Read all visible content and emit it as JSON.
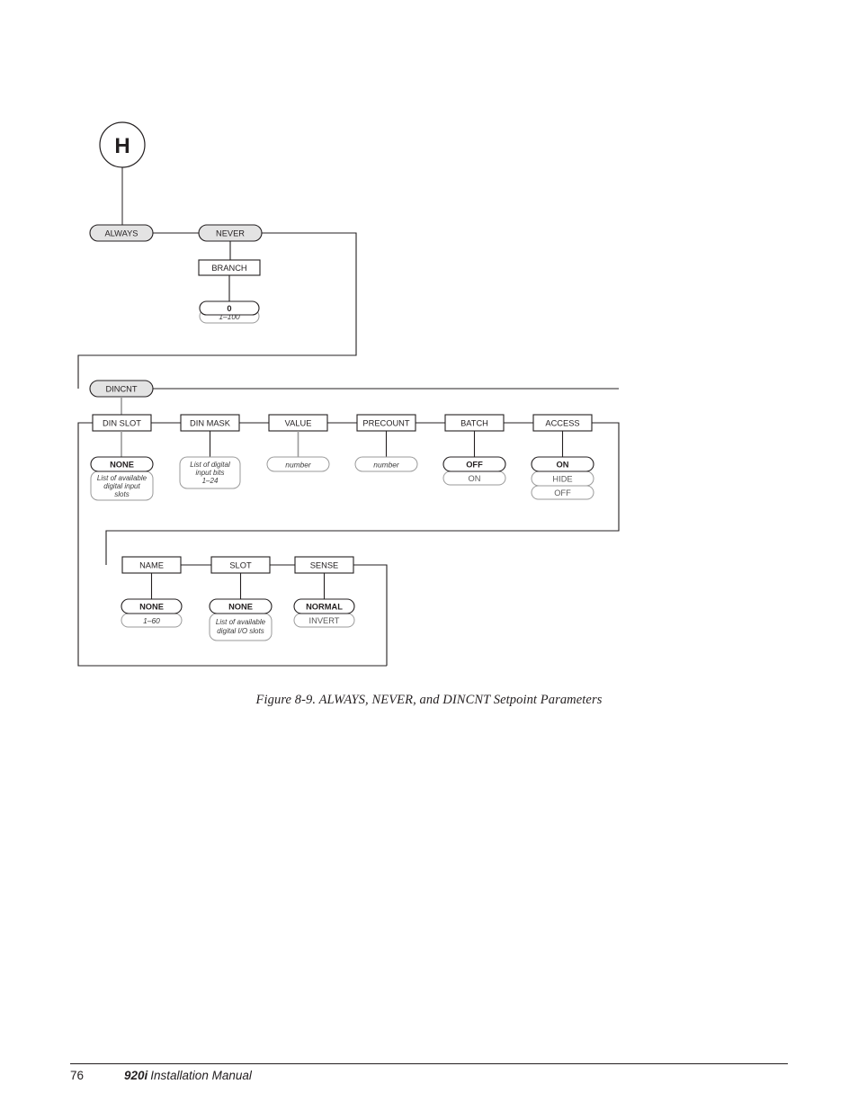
{
  "document": {
    "figure_caption": "Figure 8-9. ALWAYS, NEVER, and DINCNT Setpoint Parameters",
    "footer_page_number": "76",
    "footer_model": "920i",
    "footer_manual": "Installation Manual"
  },
  "diagram": {
    "connector": {
      "label": "H"
    },
    "nodes": {
      "always": {
        "label": "ALWAYS"
      },
      "never": {
        "label": "NEVER"
      },
      "branch": {
        "label": "BRANCH"
      },
      "branch_default": {
        "label": "0"
      },
      "branch_range": {
        "label": "1–100"
      },
      "dincnt": {
        "label": "DINCNT"
      },
      "din_slot": {
        "label": "DIN SLOT"
      },
      "din_slot_default": {
        "label": "NONE"
      },
      "din_slot_list_l1": {
        "label": "List of available"
      },
      "din_slot_list_l2": {
        "label": "digital input"
      },
      "din_slot_list_l3": {
        "label": "slots"
      },
      "din_mask": {
        "label": "DIN MASK"
      },
      "din_mask_list_l1": {
        "label": "List of digital"
      },
      "din_mask_list_l2": {
        "label": "input bits"
      },
      "din_mask_list_l3": {
        "label": "1–24"
      },
      "value": {
        "label": "VALUE"
      },
      "value_opt": {
        "label": "number"
      },
      "precount": {
        "label": "PRECOUNT"
      },
      "precount_opt": {
        "label": "number"
      },
      "batch": {
        "label": "BATCH"
      },
      "batch_opt_1": {
        "label": "OFF"
      },
      "batch_opt_2": {
        "label": "ON"
      },
      "access": {
        "label": "ACCESS"
      },
      "access_opt_1": {
        "label": "ON"
      },
      "access_opt_2": {
        "label": "HIDE"
      },
      "access_opt_3": {
        "label": "OFF"
      },
      "name": {
        "label": "NAME"
      },
      "name_default": {
        "label": "NONE"
      },
      "name_range": {
        "label": "1–60"
      },
      "slot": {
        "label": "SLOT"
      },
      "slot_default": {
        "label": "NONE"
      },
      "slot_list_l1": {
        "label": "List of available"
      },
      "slot_list_l2": {
        "label": "digital I/O slots"
      },
      "sense": {
        "label": "SENSE"
      },
      "sense_opt_1": {
        "label": "NORMAL"
      },
      "sense_opt_2": {
        "label": "INVERT"
      }
    },
    "colors": {
      "line": "#231f20",
      "pill_fill": "#e3e3e3",
      "gray_line": "#9a9a9a",
      "text": "#231f20"
    }
  }
}
